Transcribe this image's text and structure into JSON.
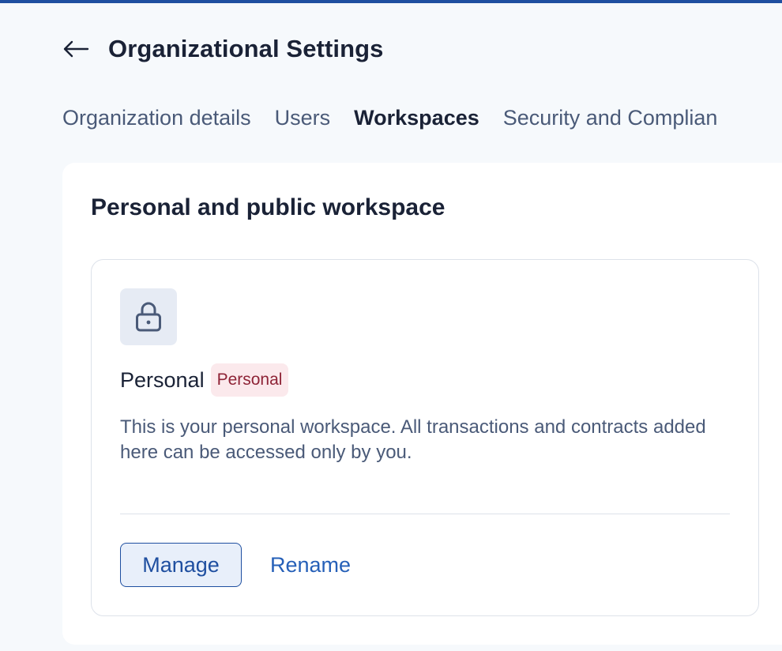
{
  "header": {
    "title": "Organizational Settings",
    "back_icon": "arrow-left-icon"
  },
  "tabs": [
    {
      "label": "Organization details",
      "active": false
    },
    {
      "label": "Users",
      "active": false
    },
    {
      "label": "Workspaces",
      "active": true
    },
    {
      "label": "Security and Complian",
      "active": false
    }
  ],
  "section": {
    "title": "Personal and public workspace"
  },
  "workspace": {
    "icon": "lock-icon",
    "name": "Personal",
    "badge": "Personal",
    "description": "This is your personal workspace. All transactions and contracts added here can be accessed only by you.",
    "manage_label": "Manage",
    "rename_label": "Rename"
  },
  "colors": {
    "accent": "#1f4fa0",
    "link": "#2660b8",
    "badge_bg": "#fbe9ec",
    "badge_text": "#8e2336",
    "page_bg": "#f6f9fc"
  }
}
